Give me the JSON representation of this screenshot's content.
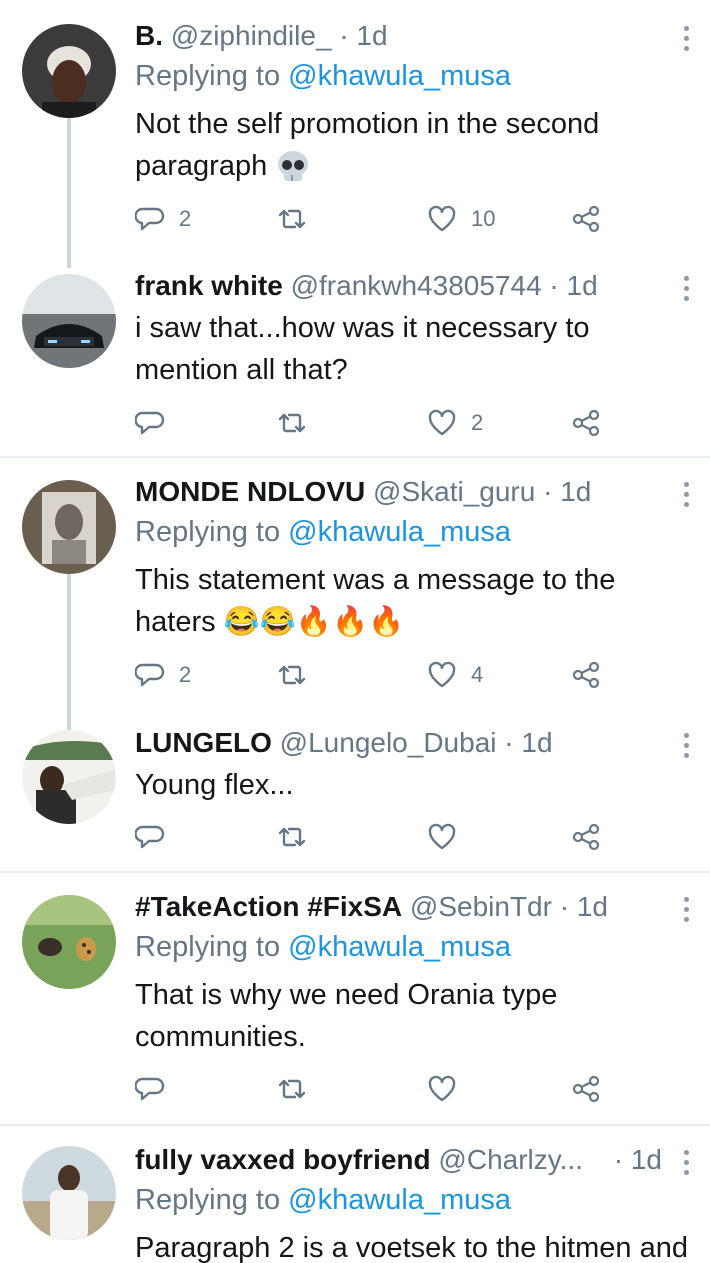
{
  "tweets": [
    {
      "name": "B.",
      "handle": "@ziphindile_",
      "time": "· 1d",
      "replying_label": "Replying to",
      "replying_to": "@khawula_musa",
      "body_line1": "Not the self promotion in the second",
      "body_line2": "paragraph",
      "body_emoji": "skull",
      "replies": "2",
      "retweets": "",
      "likes": "10"
    },
    {
      "name": "frank white",
      "handle": "@frankwh43805744",
      "time": "· 1d",
      "body_line1": "i saw that...how was it necessary to",
      "body_line2": "mention all that?",
      "replies": "",
      "retweets": "",
      "likes": "2"
    },
    {
      "name": "MONDE NDLOVU",
      "handle": "@Skati_guru",
      "time": "· 1d",
      "replying_label": "Replying to",
      "replying_to": "@khawula_musa",
      "body_line1": "This statement was a message to the",
      "body_line2": "haters",
      "body_emoji": "😂😂🔥🔥🔥",
      "replies": "2",
      "retweets": "",
      "likes": "4"
    },
    {
      "name": "LUNGELO",
      "handle": "@Lungelo_Dubai",
      "time": "· 1d",
      "body_line1": "Young flex...",
      "replies": "",
      "retweets": "",
      "likes": ""
    },
    {
      "name": "#TakeAction #FixSA",
      "handle": "@SebinTdr",
      "time": "· 1d",
      "replying_label": "Replying to",
      "replying_to": "@khawula_musa",
      "body_line1": "That is why we need Orania type",
      "body_line2": "communities.",
      "replies": "",
      "retweets": "",
      "likes": ""
    },
    {
      "name": "fully vaxxed boyfriend",
      "handle": "@Charlzy...",
      "time": "· 1d",
      "replying_label": "Replying to",
      "replying_to": "@khawula_musa",
      "body_line1": "Paragraph 2 is a voetsek to the hitmen and"
    }
  ],
  "icons": {
    "reply": "reply-icon",
    "retweet": "retweet-icon",
    "like": "heart-icon",
    "share": "share-icon",
    "more": "more-vertical-icon"
  },
  "colors": {
    "link": "#1b95e0",
    "muted": "#657786",
    "text": "#14171a",
    "thread_line": "#ccd6dd"
  }
}
